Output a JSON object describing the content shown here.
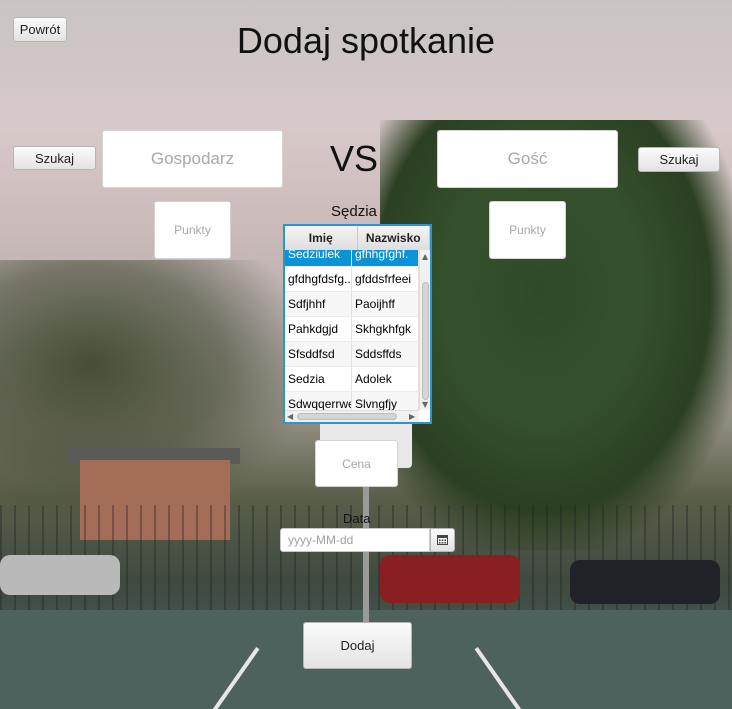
{
  "header": {
    "back_label": "Powrót",
    "title": "Dodaj spotkanie"
  },
  "host": {
    "search_label": "Szukaj",
    "name_placeholder": "Gospodarz",
    "points_placeholder": "Punkty"
  },
  "versus": "VS",
  "guest": {
    "search_label": "Szukaj",
    "name_placeholder": "Gość",
    "points_placeholder": "Punkty"
  },
  "referee": {
    "label": "Sędzia",
    "columns": [
      "Imię",
      "Nazwisko"
    ],
    "rows": [
      [
        "Sedziulek",
        "gfhhgfghf."
      ],
      [
        "gfdhgfdsfg...",
        "gfddsfrfeei"
      ],
      [
        "Sdfjhhf",
        "Paoijhff"
      ],
      [
        "Pahkdgjd",
        "Skhgkhfgk"
      ],
      [
        "Sfsddfsd",
        "Sddsffds"
      ],
      [
        "Sedzia",
        "Adolek"
      ],
      [
        "Sdwqqerrwe",
        "Slvngfjy"
      ]
    ],
    "selected_row": 0
  },
  "price": {
    "placeholder": "Cena"
  },
  "date": {
    "label": "Data",
    "placeholder": "yyyy-MM-dd",
    "picker_icon": "calendar-icon"
  },
  "submit_label": "Dodaj"
}
